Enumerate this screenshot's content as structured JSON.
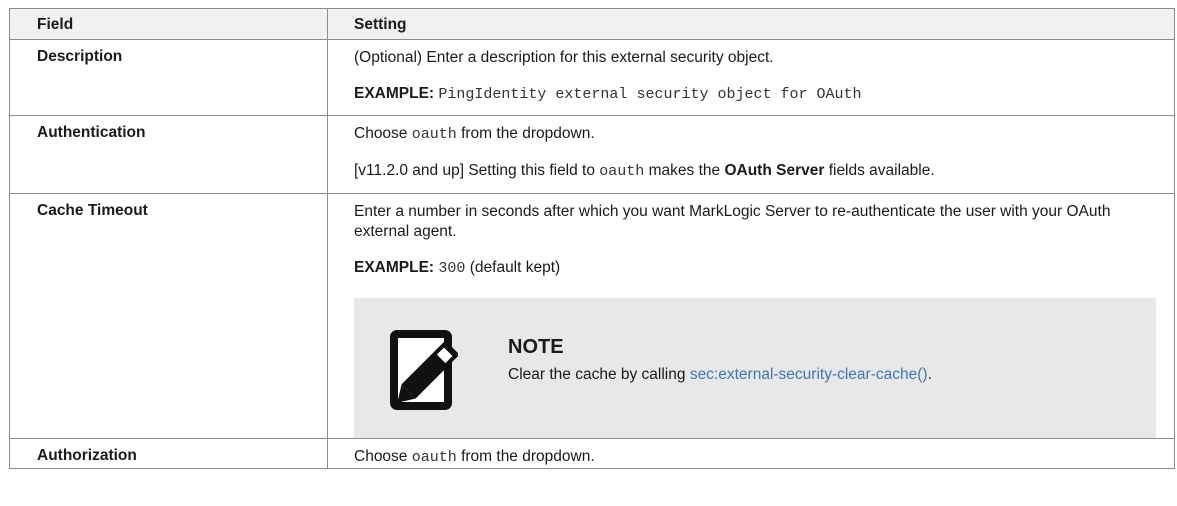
{
  "table": {
    "headers": {
      "field": "Field",
      "setting": "Setting"
    },
    "rows": {
      "description": {
        "field": "Description",
        "text": "(Optional) Enter a description for this external security object.",
        "example_label": "EXAMPLE:",
        "example_code": "PingIdentity external security object for OAuth"
      },
      "authentication": {
        "field": "Authentication",
        "choose_prefix": "Choose",
        "choose_code": "oauth",
        "choose_suffix": "from the dropdown.",
        "version_prefix": "[v11.2.0 and up] Setting this field to",
        "version_code": "oauth",
        "version_mid": "makes the",
        "version_bold": "OAuth Server",
        "version_suffix": "fields available."
      },
      "cache_timeout": {
        "field": "Cache Timeout",
        "text": "Enter a number in seconds after which you want MarkLogic Server to re-authenticate the user with your OAuth external agent.",
        "example_label": "EXAMPLE:",
        "example_code": "300",
        "example_suffix": "(default kept)",
        "note": {
          "icon": "note-pencil-icon",
          "title": "NOTE",
          "text_prefix": "Clear the cache by calling",
          "link": "sec:external-security-clear-cache()",
          "text_suffix": "."
        }
      },
      "authorization": {
        "field": "Authorization",
        "choose_prefix": "Choose",
        "choose_code": "oauth",
        "choose_suffix": "from the dropdown."
      }
    }
  },
  "colors": {
    "header_bg": "#f1f1f1",
    "note_bg": "#e8e8e8",
    "link": "#3b78b8",
    "border": "#8c8c8c"
  }
}
